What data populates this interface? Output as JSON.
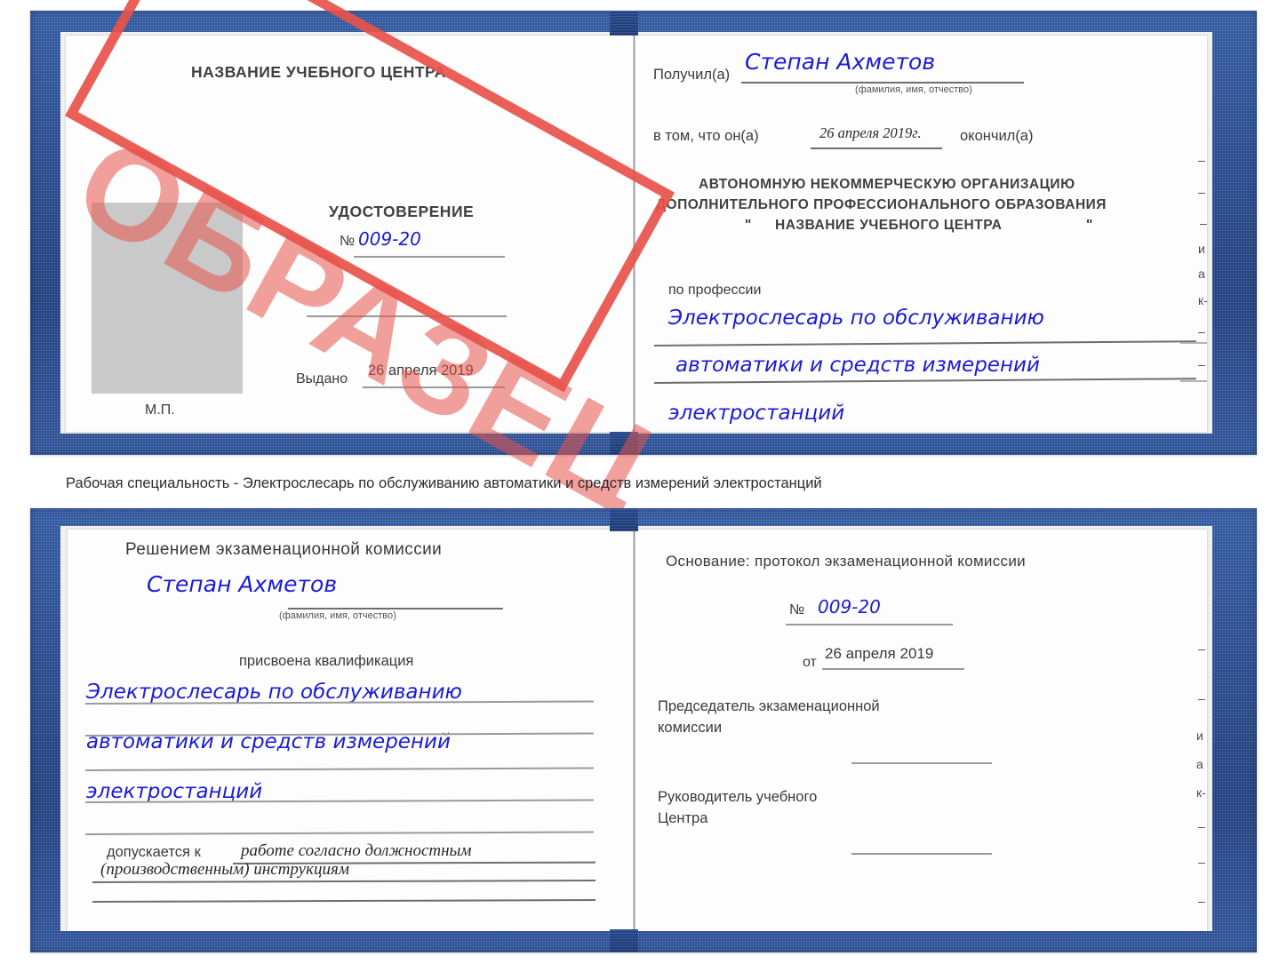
{
  "document": {
    "type": "certificate-sample",
    "stamp_text": "ОБРАЗЕЦ",
    "caption": "Рабочая специальность - Электрослесарь по обслуживанию автоматики и средств измерений электростанций",
    "colors": {
      "cover": "#24468a",
      "stamp": "#e8524a",
      "handwriting": "#1b1bd8",
      "paper": "#fdfdfd",
      "photo_placeholder": "#c9c9c9"
    }
  },
  "cert_top": {
    "left_page": {
      "center_name": "НАЗВАНИЕ УЧЕБНОГО ЦЕНТРА",
      "doc_title": "УДОСТОВЕРЕНИЕ",
      "number_label": "№",
      "number_value": "009-20",
      "issued_label": "Выдано",
      "issued_value": "26 апреля 2019",
      "seal_label": "М.П."
    },
    "right_page": {
      "received_label": "Получил(а)",
      "received_value": "Степан Ахметов",
      "name_hint": "(фамилия, имя, отчество)",
      "in_that_label": "в том, что он(а)",
      "in_that_value": "26 апреля 2019г.",
      "finished_label": "окончил(а)",
      "org_line1": "АВТОНОМНУЮ НЕКОММЕРЧЕСКУЮ ОРГАНИЗАЦИЮ",
      "org_line2": "ДОПОЛНИТЕЛЬНОГО ПРОФЕССИОНАЛЬНОГО ОБРАЗОВАНИЯ",
      "org_quote_open": "\"",
      "org_line3": "НАЗВАНИЕ УЧЕБНОГО ЦЕНТРА",
      "org_quote_close": "\"",
      "profession_label": "по профессии",
      "profession_line1": "Электрослесарь по обслуживанию",
      "profession_line2": "автоматики и средств измерений",
      "profession_line3": "электростанций"
    },
    "margin_marks": [
      "–",
      "–",
      "–",
      "и",
      "а",
      "к-",
      "–",
      "–"
    ]
  },
  "cert_bottom": {
    "left_page": {
      "decision_title": "Решением экзаменационной комиссии",
      "name_value": "Степан Ахметов",
      "name_hint": "(фамилия, имя, отчество)",
      "qualification_label": "присвоена квалификация",
      "qualification_line1": "Электрослесарь по обслуживанию",
      "qualification_line2": "автоматики и средств измерений",
      "qualification_line3": "электростанций",
      "admitted_label": "допускается к",
      "admitted_line1": "работе согласно должностным",
      "admitted_line2": "(производственным) инструкциям"
    },
    "right_page": {
      "basis_label": "Основание: протокол экзаменационной комиссии",
      "number_label": "№",
      "number_value": "009-20",
      "date_label": "от",
      "date_value": "26 апреля 2019",
      "chairman_line1": "Председатель экзаменационной",
      "chairman_line2": "комиссии",
      "head_line1": "Руководитель учебного",
      "head_line2": "Центра"
    },
    "margin_marks": [
      "–",
      "–",
      "и",
      "а",
      "к-",
      "–",
      "–",
      "–"
    ]
  }
}
